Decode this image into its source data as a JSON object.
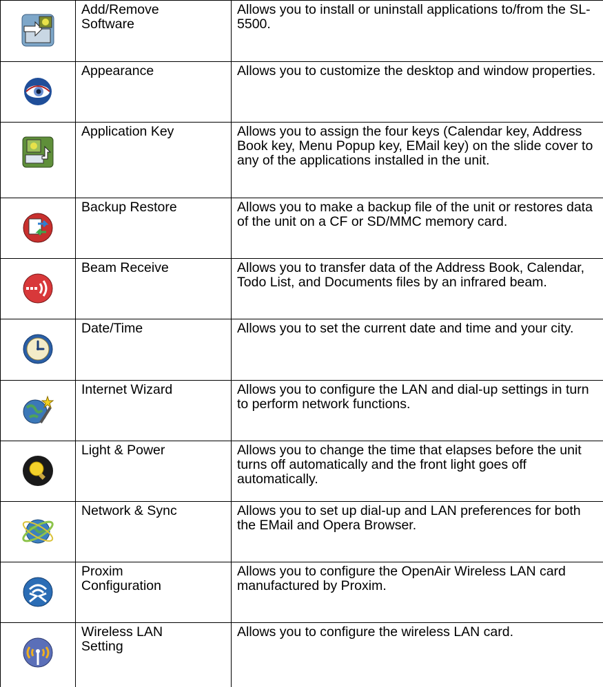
{
  "rows": [
    {
      "icon": "add-remove-software-icon",
      "name": "Add/Remove\nSoftware",
      "description": "Allows you to install or uninstall applications to/from the SL-5500."
    },
    {
      "icon": "eye-icon",
      "name": "Appearance",
      "description": "Allows you to customize the desktop and window properties."
    },
    {
      "icon": "application-key-icon",
      "name": "Application Key",
      "description": "Allows you to assign the four keys (Calendar key, Address Book key, Menu Popup key, EMail key) on the slide cover to any of the applications installed in the unit."
    },
    {
      "icon": "backup-restore-icon",
      "name": "Backup Restore",
      "description": "Allows you to make a backup file of the unit or restores data of the unit on a CF or SD/MMC memory card."
    },
    {
      "icon": "beam-receive-icon",
      "name": "Beam Receive",
      "description": "Allows you to transfer data of the Address Book, Calendar, Todo List, and Documents files by an infrared beam."
    },
    {
      "icon": "clock-icon",
      "name": "Date/Time",
      "description": "Allows you to set the current date and time and your city."
    },
    {
      "icon": "internet-wizard-icon",
      "name": "Internet Wizard",
      "description": "Allows you to configure the LAN and dial-up settings in turn to perform network functions."
    },
    {
      "icon": "light-bulb-icon",
      "name": "Light & Power",
      "description": "Allows you to change the time that elapses before the unit turns off automatically and the front light goes off automatically."
    },
    {
      "icon": "globe-sync-icon",
      "name": "Network & Sync",
      "description": "Allows you to set up dial-up and LAN preferences for both the EMail and Opera Browser."
    },
    {
      "icon": "proxim-icon",
      "name": "Proxim\nConfiguration",
      "description": "Allows you to configure the OpenAir Wireless LAN card manufactured by Proxim."
    },
    {
      "icon": "wireless-antenna-icon",
      "name": "Wireless LAN\nSetting",
      "description": "Allows you to configure the wireless LAN card."
    }
  ]
}
